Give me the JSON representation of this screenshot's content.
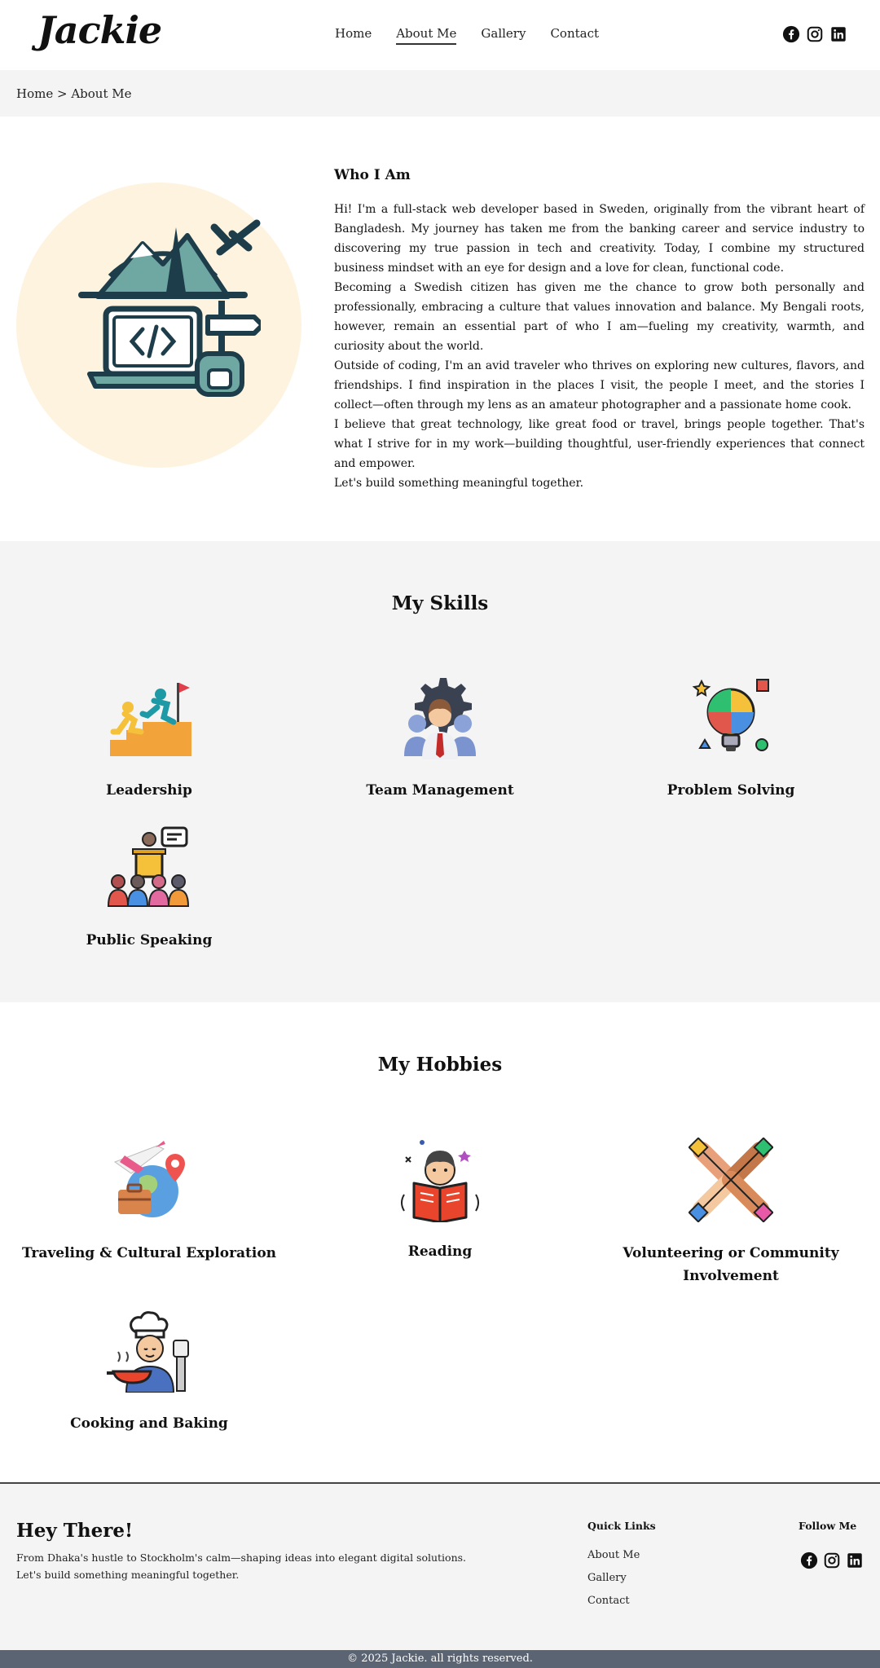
{
  "header": {
    "logo": "Jackie",
    "nav": [
      "Home",
      "About Me",
      "Gallery",
      "Contact"
    ],
    "active_nav": "About Me",
    "social": [
      "facebook-icon",
      "instagram-icon",
      "linkedin-icon"
    ]
  },
  "breadcrumb": "Home > About Me",
  "about": {
    "title": "Who I Am",
    "paragraphs": [
      "Hi! I'm a full-stack web developer based in Sweden, originally from the vibrant heart of Bangladesh. My journey has taken me from the banking career and service industry to discovering my true passion in tech and creativity. Today, I combine my structured business mindset with an eye for design and a love for clean, functional code.",
      "Becoming a Swedish citizen has given me the chance to grow both personally and professionally, embracing a culture that values innovation and balance. My Bengali roots, however, remain an essential part of who I am—fueling my creativity, warmth, and curiosity about the world.",
      "Outside of coding, I'm an avid traveler who thrives on exploring new cultures, flavors, and friendships. I find inspiration in the places I visit, the people I meet, and the stories I collect—often through my lens as an amateur photographer and a passionate home cook.",
      "I believe that great technology, like great food or travel, brings people together. That's what I strive for in my work—building thoughtful, user-friendly experiences that connect and empower.",
      "Let's build something meaningful together."
    ]
  },
  "skills": {
    "title": "My Skills",
    "items": [
      "Leadership",
      "Team Management",
      "Problem Solving",
      "Public Speaking"
    ]
  },
  "hobbies": {
    "title": "My Hobbies",
    "items": [
      "Traveling & Cultural Exploration",
      "Reading",
      "Volunteering or Community Involvement",
      "Cooking and Baking"
    ]
  },
  "footer": {
    "title": "Hey There!",
    "desc_line1": "From Dhaka's hustle to Stockholm's calm—shaping ideas into elegant digital solutions.",
    "desc_line2": "Let's build something meaningful together.",
    "quick_links_title": "Quick Links",
    "quick_links": [
      "About Me",
      "Gallery",
      "Contact"
    ],
    "follow_title": "Follow Me"
  },
  "copyright": "© 2025 Jackie. all rights reserved.",
  "colors": {
    "accent_dark": "#1d3d4a",
    "circle_bg": "#fdf3df",
    "section_bg": "#f4f4f4",
    "copyright_bg": "#5a6473"
  }
}
